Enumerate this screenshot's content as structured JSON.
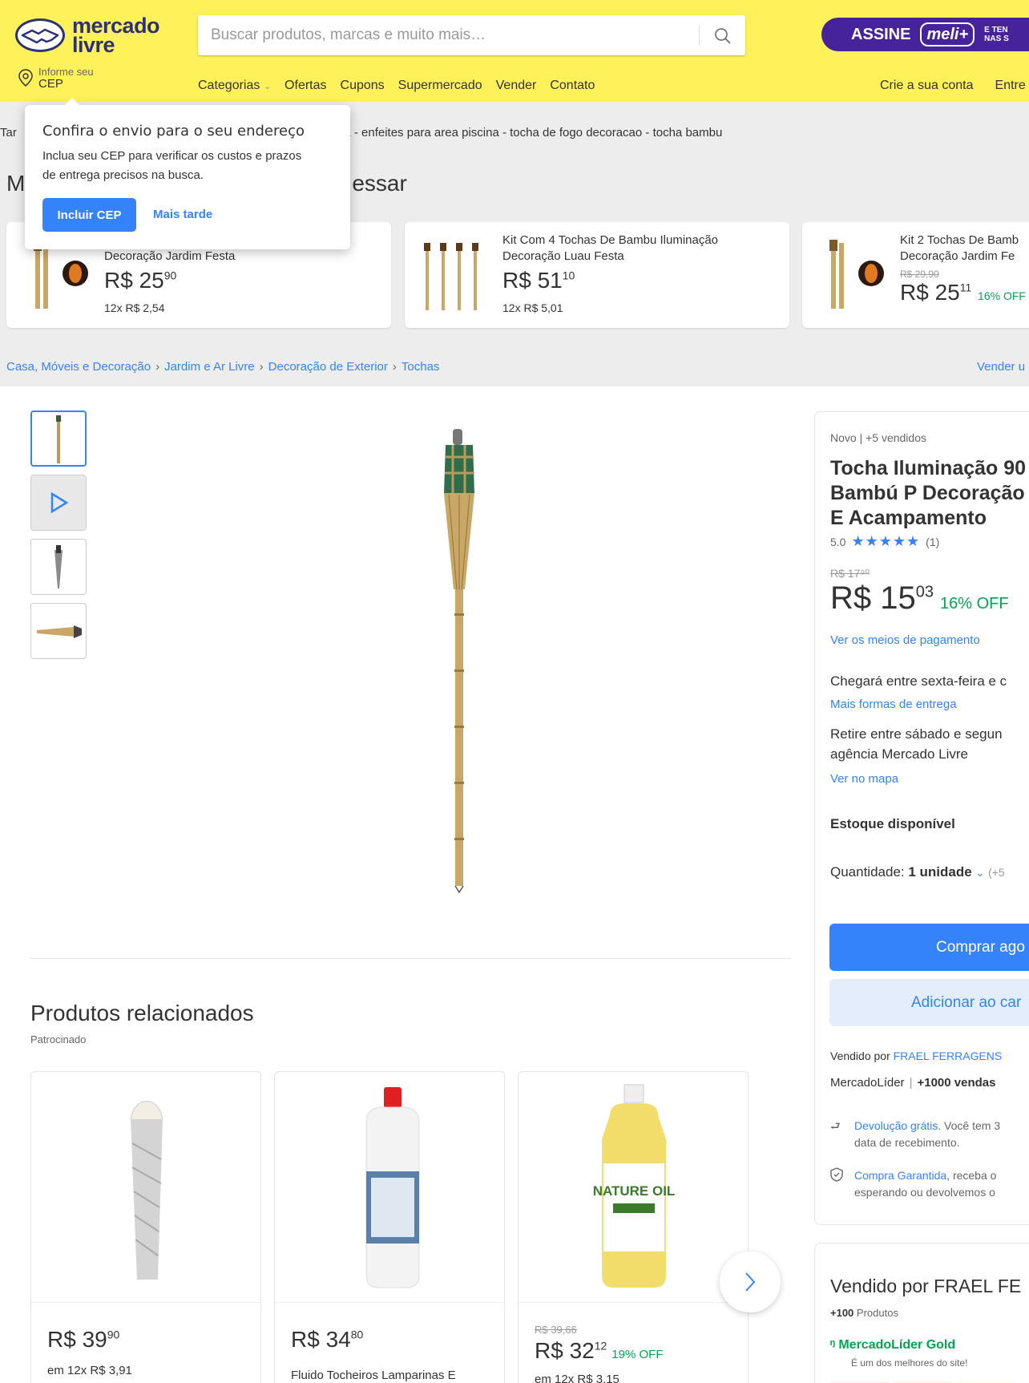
{
  "header": {
    "logo_line1": "mercado",
    "logo_line2": "livre",
    "search_placeholder": "Buscar produtos, marcas e muito mais…",
    "promo_assine": "ASSINE",
    "promo_meli": "meli+",
    "promo_small1": "E TEN",
    "promo_small2": "NAS S",
    "cep_line1": "Informe seu",
    "cep_line2": "CEP",
    "nav": [
      "Categorias",
      "Ofertas",
      "Cupons",
      "Supermercado",
      "Vender",
      "Contato"
    ],
    "account": [
      "Crie a sua conta",
      "Entre"
    ]
  },
  "popup": {
    "title": "Confira o envio para o seu endereço",
    "description": "Inclua seu CEP para verificar os custos e prazos de entrega precisos na busca.",
    "primary_button": "Incluir CEP",
    "secondary_button": "Mais tarde"
  },
  "tagline": "Tam                                                                     sa - enfeites para area piscina - tocha de fogo decoracao - tocha bambu",
  "tagline_left": "Tar",
  "tagline_right": "sa - enfeites para area piscina - tocha de fogo decoracao - tocha bambu",
  "recommend": {
    "title_left": "M",
    "title_right": "essar",
    "cards": [
      {
        "title_line1": "n",
        "title_line2": "Decoração Jardim Festa",
        "old": "",
        "price_int": "R$ 25",
        "price_cents": "90",
        "off": "",
        "installments": "12x R$ 2,54"
      },
      {
        "title_line1": "Kit Com 4 Tochas De Bambu Iluminação",
        "title_line2": "Decoração Luau Festa",
        "old": "",
        "price_int": "R$ 51",
        "price_cents": "10",
        "off": "",
        "installments": "12x R$ 5,01"
      },
      {
        "title_line1": "Kit 2 Tochas De Bamb",
        "title_line2": "Decoração Jardim Fe",
        "old": "R$ 29,90",
        "price_int": "R$ 25",
        "price_cents": "11",
        "off": "16% OFF",
        "installments": ""
      }
    ]
  },
  "breadcrumb": [
    "Casa, Móveis e Decoração",
    "Jardim e Ar Livre",
    "Decoração de Exterior",
    "Tochas"
  ],
  "vender": "Vender u",
  "product": {
    "condition": "Novo  |  +5 vendidos",
    "title": "Tocha Iluminação 90 Bambú P Decoração E Acampamento",
    "title_l1": "Tocha Iluminação 90",
    "title_l2": "Bambú P Decoração",
    "title_l3": "E Acampamento",
    "rating": "5.0",
    "stars": "★★★★★",
    "reviews": "(1)",
    "old_price": "R$ 17⁹⁰",
    "price_int": "R$ 15",
    "price_cents": "03",
    "off": "16% OFF",
    "payment_link": "Ver os meios de pagamento",
    "delivery": "Chegará entre sexta-feira e c",
    "delivery_link": "Mais formas de entrega",
    "pickup_l1": "Retire entre sábado e segun",
    "pickup_l2": "agência Mercado Livre",
    "map_link": "Ver no mapa",
    "stock": "Estoque disponível",
    "qty_label": "Quantidade: ",
    "qty_value": "1 unidade",
    "qty_more": "(+5",
    "buy": "Comprar ago",
    "cart": "Adicionar ao car",
    "sold_by": "Vendido por ",
    "seller": "FRAEL FERRAGENS",
    "leader": "MercadoLíder",
    "sales": "+1000 vendas",
    "return_link": "Devolução grátis",
    "return_text": ". Você tem 3",
    "return_text2": "data de recebimento.",
    "guarantee_link": "Compra Garantida",
    "guarantee_text": ", receba o",
    "guarantee_text2": "esperando ou devolvemos o"
  },
  "seller_box": {
    "title": "Vendido por FRAEL FE",
    "products_bold": "+100",
    "products": " Produtos",
    "level": "MercadoLíder Gold",
    "level_sub": "É um dos melhores do site!"
  },
  "related": {
    "title": "Produtos relacionados",
    "sponsored": "Patrocinado",
    "items": [
      {
        "old": "",
        "price_int": "R$ 39",
        "price_cents": "90",
        "off": "",
        "line": "em 12x R$ 3,91"
      },
      {
        "old": "",
        "price_int": "R$ 34",
        "price_cents": "80",
        "off": "",
        "line": "Fluido Tocheiros Lamparinas E"
      },
      {
        "old": "R$ 39,66",
        "price_int": "R$ 32",
        "price_cents": "12",
        "off": "19% OFF",
        "line": "em 12x R$ 3,15"
      }
    ]
  },
  "colors": {
    "yellow": "#fff159",
    "blue": "#3483fa",
    "green": "#00a650",
    "purple": "#47239b"
  },
  "icons": [
    "mercado-livre-handshake-logo",
    "search-icon",
    "location-pin-icon",
    "chevron-down-icon",
    "return-arrow-icon",
    "shield-check-icon",
    "medal-icon",
    "chevron-right-icon",
    "play-icon"
  ]
}
